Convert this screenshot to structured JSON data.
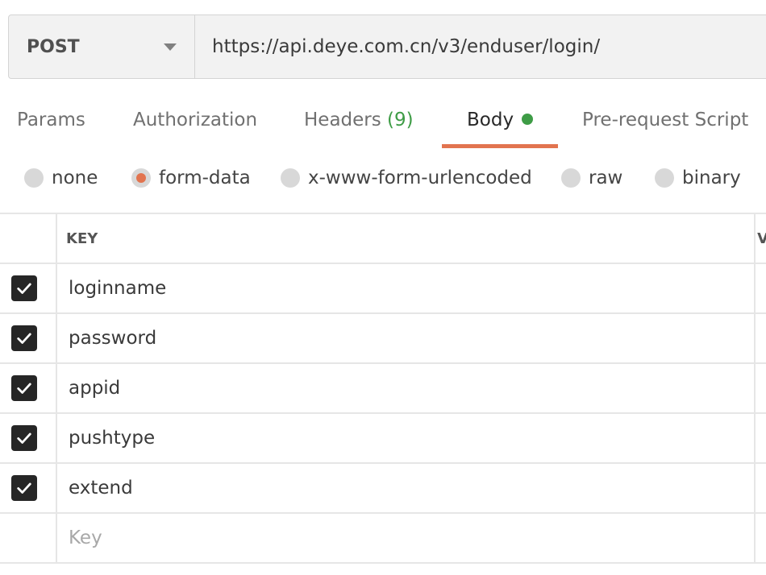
{
  "request": {
    "method": "POST",
    "url": "https://api.deye.com.cn/v3/enduser/login/"
  },
  "tabs": {
    "params": "Params",
    "authorization": "Authorization",
    "headers": "Headers",
    "headers_count": "(9)",
    "body": "Body",
    "prerequest": "Pre-request Script",
    "active": "Body"
  },
  "body_types": {
    "none": "none",
    "form_data": "form-data",
    "urlencoded": "x-www-form-urlencoded",
    "raw": "raw",
    "binary": "binary",
    "selected": "form-data"
  },
  "table": {
    "key_header": "KEY",
    "next_header_fragment": "V",
    "rows": [
      {
        "key": "loginname",
        "checked": true
      },
      {
        "key": "password",
        "checked": true
      },
      {
        "key": "appid",
        "checked": true
      },
      {
        "key": "pushtype",
        "checked": true
      },
      {
        "key": "extend",
        "checked": true
      }
    ],
    "new_key_placeholder": "Key"
  },
  "colors": {
    "accent": "#e2744f",
    "success": "#3e9c46"
  },
  "icons": {
    "method_caret": "chevron-down-icon",
    "checkbox": "check-icon",
    "body_indicator": "green-dot-icon"
  }
}
